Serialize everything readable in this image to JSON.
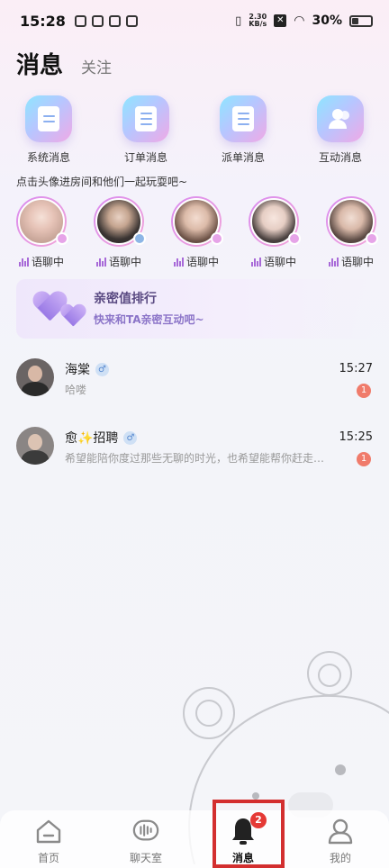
{
  "status_bar": {
    "time": "15:28",
    "speed_value": "2.30",
    "speed_unit": "KB/s",
    "battery": "30%"
  },
  "header": {
    "title": "消息",
    "follow_tab": "关注"
  },
  "quick_actions": [
    {
      "label": "系统消息",
      "icon": "system-message-icon"
    },
    {
      "label": "订单消息",
      "icon": "order-message-icon"
    },
    {
      "label": "派单消息",
      "icon": "dispatch-message-icon"
    },
    {
      "label": "互动消息",
      "icon": "interaction-message-icon"
    }
  ],
  "hint": "点击头像进房间和他们一起玩耍吧~",
  "live_users": [
    {
      "status": "语聊中",
      "gender": "female"
    },
    {
      "status": "语聊中",
      "gender": "male"
    },
    {
      "status": "语聊中",
      "gender": "female"
    },
    {
      "status": "语聊中",
      "gender": "female"
    },
    {
      "status": "语聊中",
      "gender": "female"
    }
  ],
  "banner": {
    "title": "亲密值排行",
    "subtitle": "快来和TA亲密互动吧~"
  },
  "conversations": [
    {
      "name": "海棠",
      "gender_symbol": "♂",
      "preview": "哈喽",
      "time": "15:27",
      "unread": "1"
    },
    {
      "name": "愈✨招聘",
      "gender_symbol": "♂",
      "preview": "希望能陪你度过那些无聊的时光，也希望能帮你赶走…",
      "time": "15:25",
      "unread": "1"
    }
  ],
  "tabs": [
    {
      "label": "首页",
      "icon": "home-icon"
    },
    {
      "label": "聊天室",
      "icon": "chatroom-icon"
    },
    {
      "label": "消息",
      "icon": "bell-icon",
      "badge": "2",
      "active": true
    },
    {
      "label": "我的",
      "icon": "profile-icon"
    }
  ],
  "colors": {
    "accent": "#9a7ae6",
    "badge": "#e53935",
    "unread": "#f07b6b"
  }
}
